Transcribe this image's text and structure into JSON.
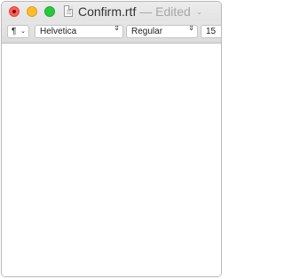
{
  "window": {
    "filename": "Confirm.rtf",
    "separator": "—",
    "status": "Edited",
    "status_chevron": "⌄",
    "icons": {
      "close": "close-icon",
      "minimize": "minimize-icon",
      "zoom": "zoom-icon",
      "document": "document-icon"
    }
  },
  "toolbar": {
    "paragraph_symbol": "¶",
    "paragraph_chevron": "⌄",
    "font_family": "Helvetica",
    "font_style": "Regular",
    "font_size": "15",
    "stepper_symbol": "⇕"
  },
  "colors": {
    "close": "#fc5f57",
    "minimize": "#fdbc2e",
    "zoom": "#28c840"
  },
  "document": {
    "text": ""
  }
}
